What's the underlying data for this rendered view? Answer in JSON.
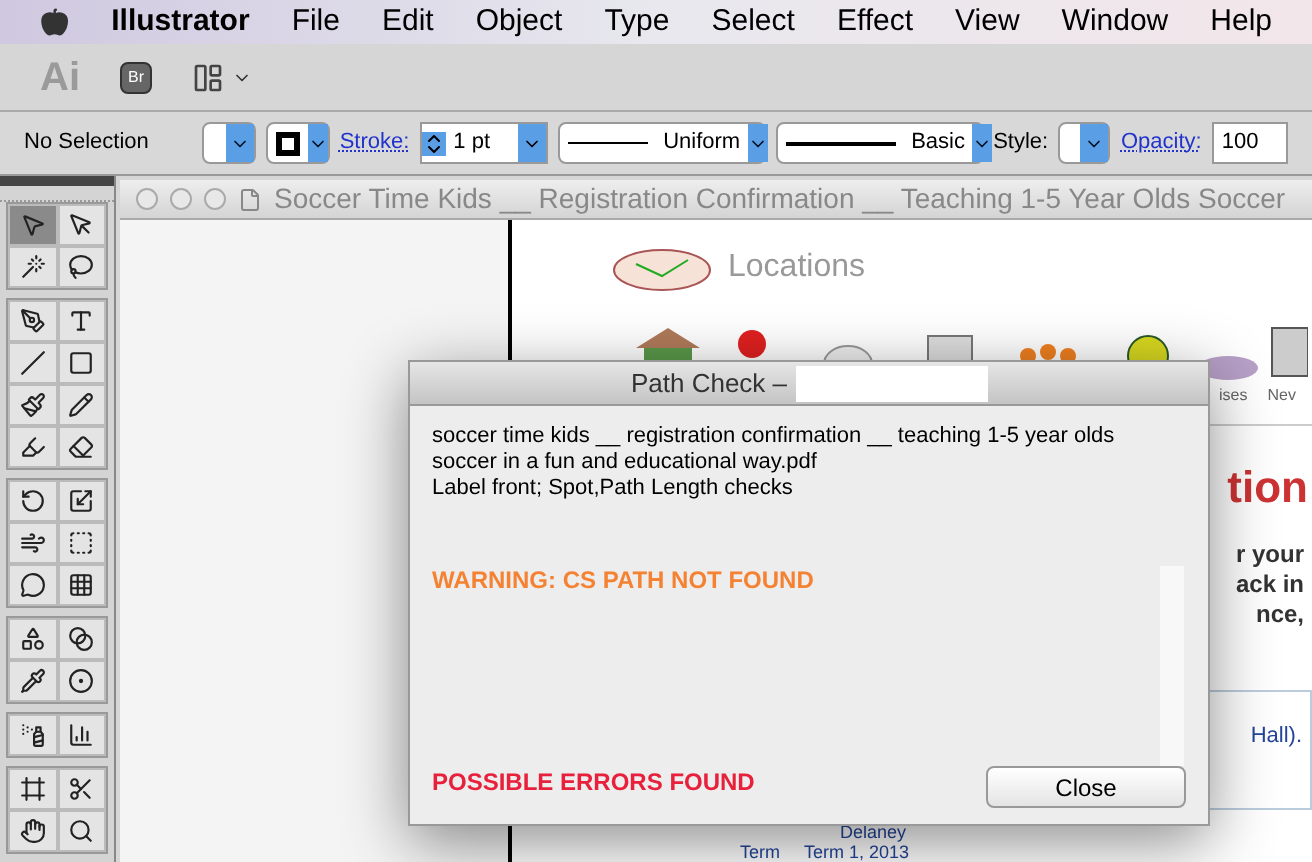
{
  "menu_bar": {
    "app": "Illustrator",
    "items": [
      "File",
      "Edit",
      "Object",
      "Type",
      "Select",
      "Effect",
      "View",
      "Window",
      "Help"
    ]
  },
  "app_bar": {
    "logo": "Ai",
    "bridge": "Br"
  },
  "control_bar": {
    "selection": "No Selection",
    "stroke_label": "Stroke:",
    "stroke_weight": "1 pt",
    "profile": "Uniform",
    "brush": "Basic",
    "style_label": "Style:",
    "opacity_label": "Opacity:",
    "opacity": "100"
  },
  "tools": [
    {
      "selected": true
    },
    {
      "selected": false
    },
    {
      "selected": false
    },
    {
      "selected": false
    },
    {
      "selected": false
    },
    {
      "selected": false
    },
    {
      "selected": false
    },
    {
      "selected": false
    },
    {
      "selected": false
    },
    {
      "selected": false
    },
    {
      "selected": false
    },
    {
      "selected": false
    },
    {
      "selected": false
    },
    {
      "selected": false
    },
    {
      "selected": false
    },
    {
      "selected": false
    },
    {
      "selected": false
    },
    {
      "selected": false
    },
    {
      "selected": false
    },
    {
      "selected": false
    },
    {
      "selected": false
    },
    {
      "selected": false
    },
    {
      "selected": false
    },
    {
      "selected": false
    },
    {
      "selected": false
    },
    {
      "selected": false
    },
    {
      "selected": false
    },
    {
      "selected": false
    }
  ],
  "document": {
    "title": "Soccer Time Kids __ Registration Confirmation __ Teaching 1-5 Year Olds Soccer",
    "heading": "Locations",
    "nav_labels": [
      "ises",
      "Nev"
    ],
    "banner_text": "tion",
    "body_lines": [
      "r your",
      "ack in",
      "nce,"
    ],
    "info": {
      "link": "Hall).",
      "name": "Delaney",
      "term_label": "Term",
      "term": "Term 1, 2013"
    }
  },
  "dialog": {
    "title": "Path Check –",
    "lines": [
      "soccer time kids __ registration confirmation __ teaching 1-5 year olds",
      "soccer in a fun and educational way.pdf",
      "Label front; Spot,Path Length checks"
    ],
    "warning": "WARNING: CS PATH NOT FOUND",
    "errors": "POSSIBLE ERRORS FOUND",
    "button": "Close"
  }
}
